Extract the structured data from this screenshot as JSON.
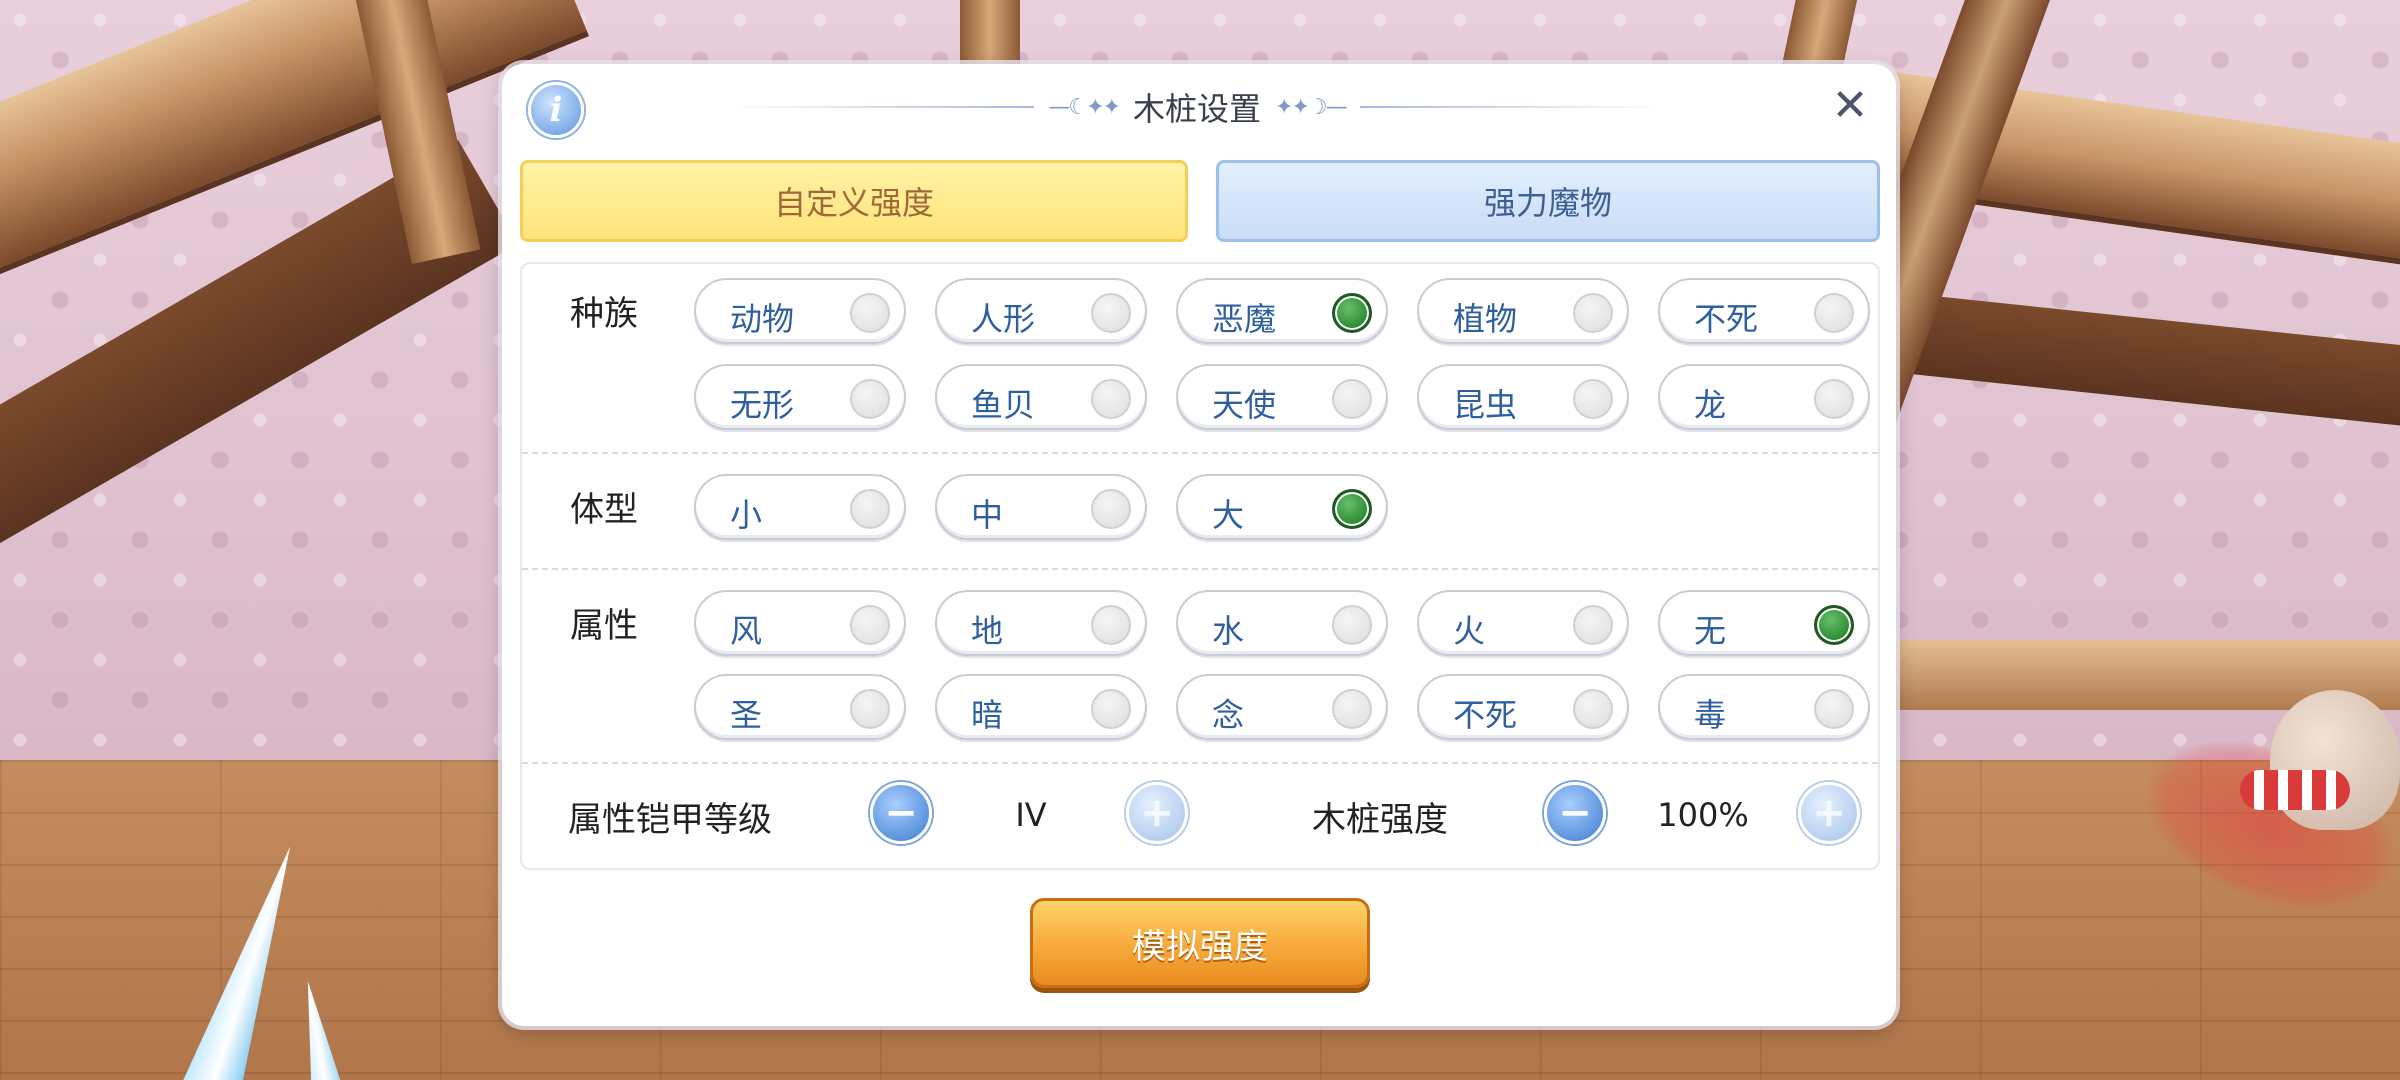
{
  "dialog": {
    "title": "木桩设置",
    "title_ornament_left": "—☾✦✦",
    "title_ornament_right": "✦✦☽—",
    "info_glyph": "i",
    "close_glyph": "✕"
  },
  "tabs": [
    {
      "label": "自定义强度",
      "selected": true
    },
    {
      "label": "强力魔物",
      "selected": false
    }
  ],
  "race": {
    "label": "种族",
    "options": [
      {
        "label": "动物",
        "selected": false
      },
      {
        "label": "人形",
        "selected": false
      },
      {
        "label": "恶魔",
        "selected": true
      },
      {
        "label": "植物",
        "selected": false
      },
      {
        "label": "不死",
        "selected": false
      },
      {
        "label": "无形",
        "selected": false
      },
      {
        "label": "鱼贝",
        "selected": false
      },
      {
        "label": "天使",
        "selected": false
      },
      {
        "label": "昆虫",
        "selected": false
      },
      {
        "label": "龙",
        "selected": false
      }
    ]
  },
  "size": {
    "label": "体型",
    "options": [
      {
        "label": "小",
        "selected": false
      },
      {
        "label": "中",
        "selected": false
      },
      {
        "label": "大",
        "selected": true
      }
    ]
  },
  "element": {
    "label": "属性",
    "options": [
      {
        "label": "风",
        "selected": false
      },
      {
        "label": "地",
        "selected": false
      },
      {
        "label": "水",
        "selected": false
      },
      {
        "label": "火",
        "selected": false
      },
      {
        "label": "无",
        "selected": true
      },
      {
        "label": "圣",
        "selected": false
      },
      {
        "label": "暗",
        "selected": false
      },
      {
        "label": "念",
        "selected": false
      },
      {
        "label": "不死",
        "selected": false
      },
      {
        "label": "毒",
        "selected": false
      }
    ]
  },
  "armor_level": {
    "label": "属性铠甲等级",
    "value": "IV",
    "minus": "−",
    "plus": "+"
  },
  "dummy_strength": {
    "label": "木桩强度",
    "value": "100%",
    "minus": "−",
    "plus": "+"
  },
  "simulate_button": "模拟强度",
  "colors": {
    "selected_radio": "#2b8a30",
    "chip_text": "#2f5f9e",
    "tab_selected": "#ffe47a",
    "tab_unselected": "#c7dcf6",
    "action_button": "#f7a93a"
  }
}
